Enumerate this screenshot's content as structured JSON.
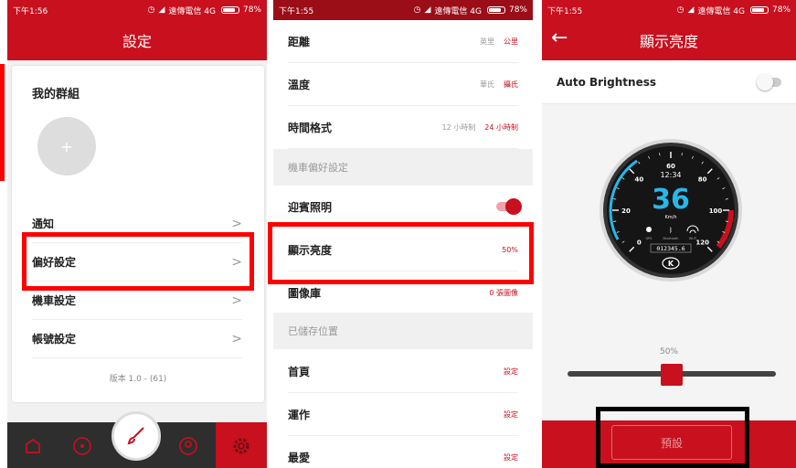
{
  "panel1": {
    "status": {
      "time": "下午1:56",
      "carrier": "遠傳電信 4G",
      "battery": "78%"
    },
    "title": "設定",
    "group_title": "我的群組",
    "add_symbol": "+",
    "rows": [
      {
        "label": "通知"
      },
      {
        "label": "偏好設定"
      },
      {
        "label": "機車設定"
      },
      {
        "label": "帳號設定"
      }
    ],
    "chevron": ">",
    "version": "版本 1.0 - (61)"
  },
  "panel2": {
    "status": {
      "time": "下午1:55",
      "carrier": "遠傳電信 4G",
      "battery": "78%"
    },
    "distance": {
      "label": "距離",
      "opt1": "英里",
      "opt2": "公里"
    },
    "temperature": {
      "label": "溫度",
      "opt1": "華氏",
      "opt2": "攝氏"
    },
    "timeformat": {
      "label": "時間格式",
      "opt1": "12 小時制",
      "opt2": "24 小時制"
    },
    "section_bike": "機車偏好設定",
    "welcome_light": {
      "label": "迎賓照明"
    },
    "brightness": {
      "label": "顯示亮度",
      "value": "50%"
    },
    "gallery": {
      "label": "圖像庫",
      "value": "0 張圖像"
    },
    "section_saved": "已儲存位置",
    "saved": [
      {
        "label": "首頁",
        "action": "設定"
      },
      {
        "label": "運作",
        "action": "設定"
      },
      {
        "label": "最愛",
        "action": "設定"
      }
    ]
  },
  "panel3": {
    "status": {
      "time": "下午1:55",
      "carrier": "遠傳電信 4G",
      "battery": "78%"
    },
    "back": "←",
    "title": "顯示亮度",
    "auto_brightness": "Auto Brightness",
    "gauge": {
      "speed": "36",
      "unit": "Km/h",
      "clock": "12:34",
      "odometer": "012345.6",
      "ticks": [
        "0",
        "20",
        "40",
        "60",
        "80",
        "100",
        "120"
      ],
      "status_labels": [
        "GPS",
        "Bluetooth",
        "Wi-Fi"
      ],
      "logo": "K"
    },
    "brightness_value": 0.5,
    "brightness_label": "50%",
    "preset_label": "預設"
  },
  "colors": {
    "brand_red": "#c8101e",
    "dark_red": "#9b0d17",
    "highlight_red": "#ff0000",
    "highlight_black": "#000000",
    "gauge_blue": "#29b6e8"
  }
}
